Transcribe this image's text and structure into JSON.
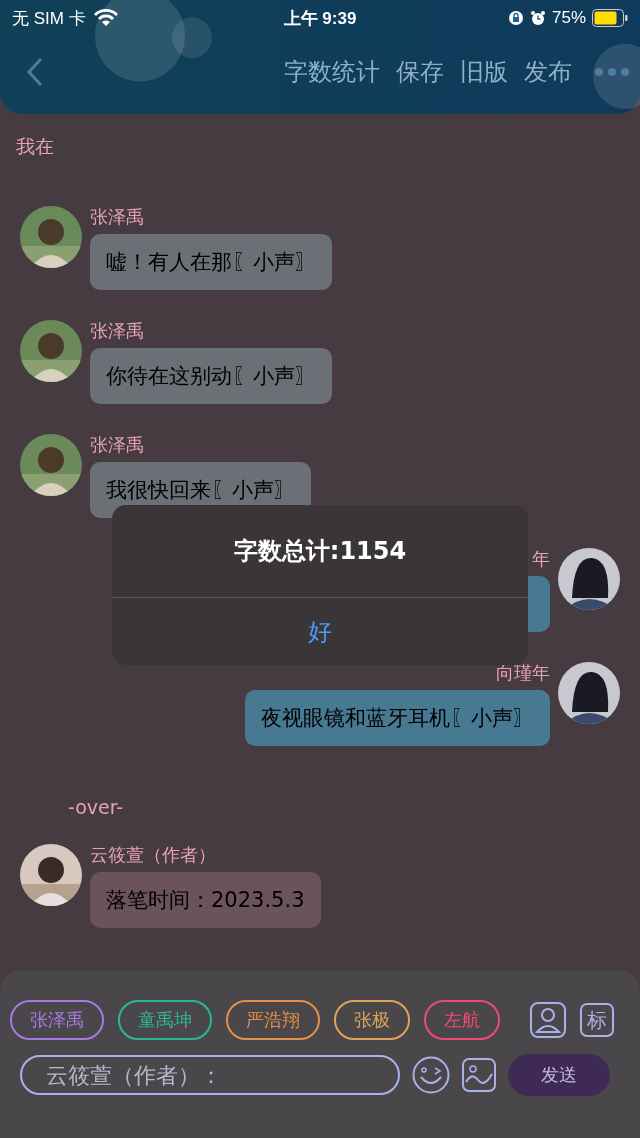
{
  "status_bar": {
    "carrier": "无 SIM 卡",
    "time": "上午 9:39",
    "battery": "75%"
  },
  "header": {
    "actions": [
      "字数统计",
      "保存",
      "旧版",
      "发布"
    ]
  },
  "messages": [
    {
      "kind": "narration",
      "text": "我在"
    },
    {
      "kind": "left",
      "name": "张泽禹",
      "text": "嘘！有人在那〖小声〗"
    },
    {
      "kind": "left",
      "name": "张泽禹",
      "text": "你待在这别动〖小声〗"
    },
    {
      "kind": "left",
      "name": "张泽禹",
      "text": "我很快回来〖小声〗"
    },
    {
      "kind": "right",
      "name": "年"
    },
    {
      "kind": "right",
      "name": "向瑾年",
      "text": "夜视眼镜和蓝牙耳机〖小声〗"
    },
    {
      "kind": "narration",
      "text": "-over-"
    },
    {
      "kind": "author",
      "name": "云筱萱（作者）",
      "text": "落笔时间：2023.5.3"
    }
  ],
  "roles": [
    {
      "label": "张泽禹",
      "color": "#a87ae0"
    },
    {
      "label": "童禹坤",
      "color": "#2cb894"
    },
    {
      "label": "严浩翔",
      "color": "#e09048"
    },
    {
      "label": "张极",
      "color": "#e0a458"
    },
    {
      "label": "左航",
      "color": "#f04a72"
    }
  ],
  "mark_button": "标",
  "input": {
    "placeholder": "云筱萱（作者）："
  },
  "send_button": "发送",
  "alert": {
    "title": "字数总计:1154",
    "button": "好"
  }
}
